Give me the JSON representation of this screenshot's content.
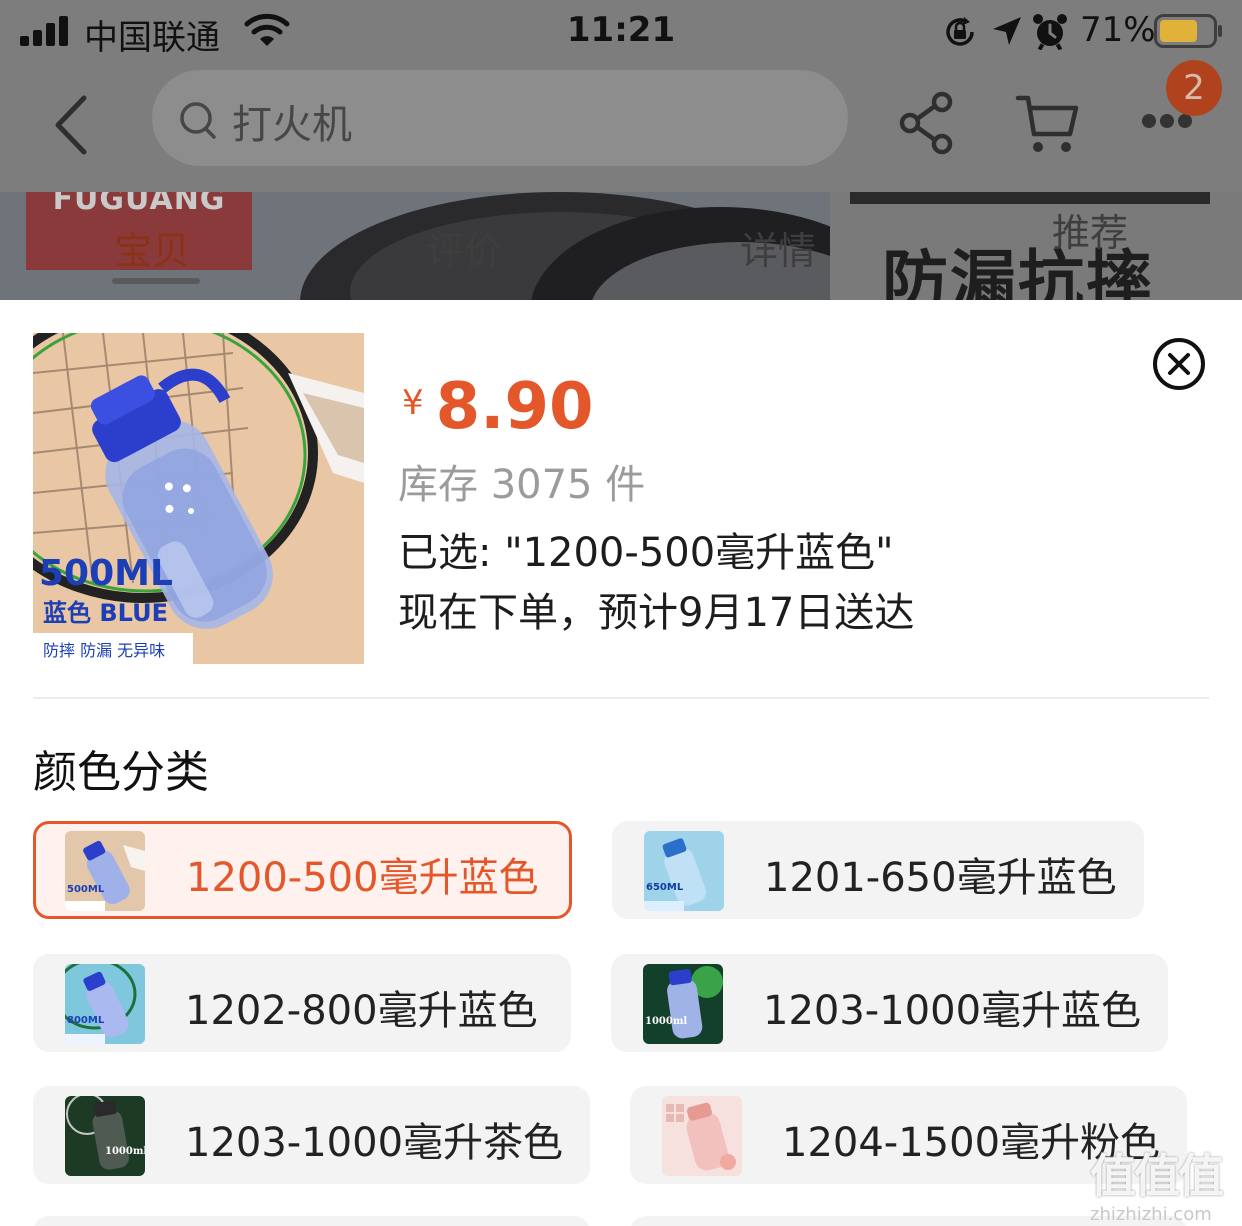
{
  "status_bar": {
    "carrier": "中国联通",
    "time": "11:21",
    "battery_percent": "71%",
    "battery_level": 0.71,
    "icons": [
      "signal-icon",
      "wifi-icon",
      "orientation-lock-icon",
      "location-icon",
      "alarm-icon",
      "battery-icon"
    ]
  },
  "nav": {
    "search_text": "打火机",
    "cart_badge": "2",
    "icons": [
      "back-icon",
      "search-icon",
      "share-icon",
      "cart-icon",
      "more-icon"
    ]
  },
  "banner": {
    "brand": "FUGUANG",
    "headline": "防漏抗摔",
    "tabs": [
      {
        "label": "宝贝",
        "active": true
      },
      {
        "label": "评价",
        "active": false
      },
      {
        "label": "详情",
        "active": false
      },
      {
        "label": "推荐",
        "active": false
      }
    ]
  },
  "sheet": {
    "currency": "¥",
    "price": "8.90",
    "stock": "库存 3075 件",
    "selected": "已选: \"1200-500毫升蓝色\"",
    "delivery": "现在下单，预计9月17日送达",
    "product_image": {
      "volume": "500ML",
      "color_text": "蓝色 BLUE",
      "features": "防摔 防漏 无异味"
    },
    "section_title": "颜色分类",
    "options": [
      {
        "label": "1200-500毫升蓝色",
        "selected": true,
        "thumb_text": "500ML"
      },
      {
        "label": "1201-650毫升蓝色",
        "selected": false,
        "thumb_text": "650ML"
      },
      {
        "label": "1202-800毫升蓝色",
        "selected": false,
        "thumb_text": "800ML"
      },
      {
        "label": "1203-1000毫升蓝色",
        "selected": false,
        "thumb_text": "1000ml"
      },
      {
        "label": "1203-1000毫升茶色",
        "selected": false,
        "thumb_text": "1000ml"
      },
      {
        "label": "1204-1500毫升粉色",
        "selected": false,
        "thumb_text": ""
      }
    ]
  },
  "watermark": {
    "glyphs": "值值值",
    "url": "zhizhizhi.com"
  },
  "colors": {
    "accent": "#e4572a",
    "accent_bg": "#fff2ee",
    "option_bg": "#f3f3f3",
    "text": "#1d1d1d",
    "muted": "#9b9b9b"
  }
}
